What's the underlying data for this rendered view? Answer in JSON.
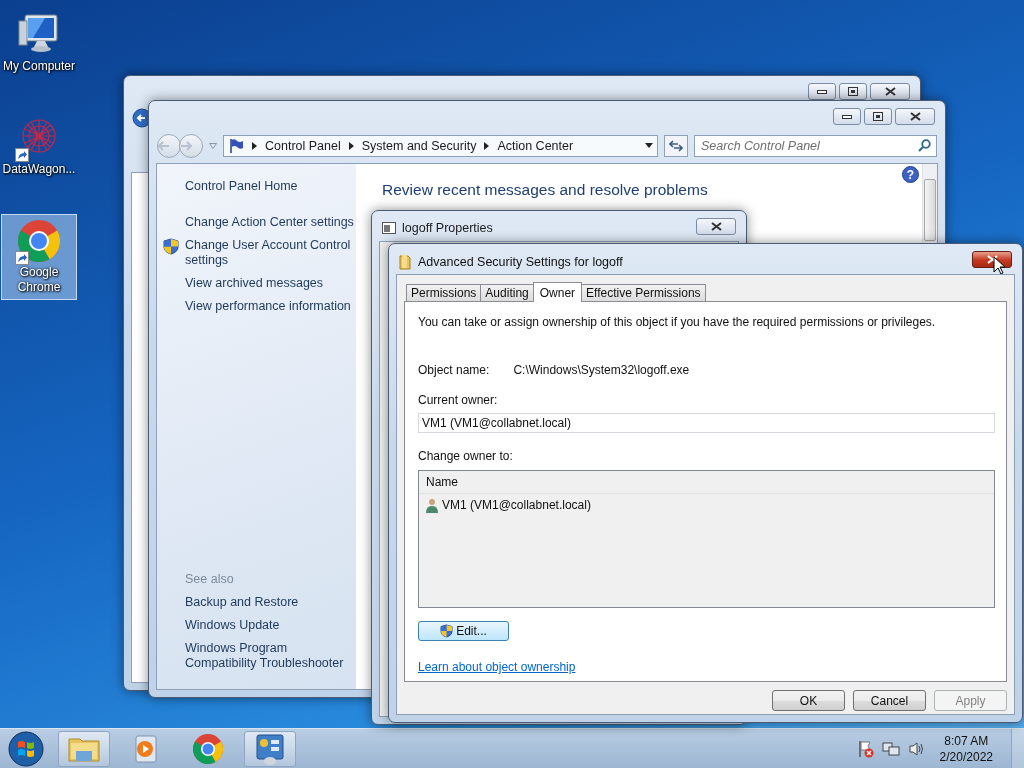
{
  "desktop_icons": [
    {
      "label": "My Computer",
      "selected": false
    },
    {
      "label": "DataWagon...",
      "selected": false
    },
    {
      "label": "Google Chrome",
      "selected": true
    }
  ],
  "control_panel": {
    "breadcrumb": [
      "Control Panel",
      "System and Security",
      "Action Center"
    ],
    "search": {
      "placeholder": "Search Control Panel"
    },
    "sidebar": {
      "home": "Control Panel Home",
      "tasks": [
        {
          "label": "Change Action Center settings",
          "kind": "plain"
        },
        {
          "label": "Change User Account Control settings",
          "kind": "shield"
        },
        {
          "label": "View archived messages",
          "kind": "plain"
        },
        {
          "label": "View performance information",
          "kind": "plain"
        }
      ],
      "see_also_title": "See also",
      "see_also": [
        "Backup and Restore",
        "Windows Update",
        "Windows Program Compatibility Troubleshooter"
      ]
    },
    "heading": "Review recent messages and resolve problems",
    "help_button": "?"
  },
  "properties_window": {
    "title": "logoff Properties"
  },
  "advanced_dialog": {
    "title": "Advanced Security Settings for logoff",
    "tabs": [
      {
        "label": "Permissions",
        "selected": false
      },
      {
        "label": "Auditing",
        "selected": false
      },
      {
        "label": "Owner",
        "selected": true
      },
      {
        "label": "Effective Permissions",
        "selected": false
      }
    ],
    "intro": "You can take or assign ownership of this object if you have the required permissions or privileges.",
    "object_name": {
      "label": "Object name:",
      "value": "C:\\Windows\\System32\\logoff.exe"
    },
    "current_owner": {
      "label": "Current owner:",
      "value": "VM1 (VM1@collabnet.local)"
    },
    "change_owner": {
      "label": "Change owner to:",
      "columns": [
        "Name"
      ],
      "rows": [
        {
          "name": "VM1 (VM1@collabnet.local)",
          "selected": false
        }
      ]
    },
    "edit_button": "Edit...",
    "link": "Learn about object ownership",
    "buttons": [
      {
        "label": "OK",
        "disabled": false
      },
      {
        "label": "Cancel",
        "disabled": false
      },
      {
        "label": "Apply",
        "disabled": true
      }
    ]
  },
  "taskbar": {
    "apps": [
      {
        "kind": "explorer",
        "running": true
      },
      {
        "kind": "media",
        "running": false
      },
      {
        "kind": "chrome",
        "running": false
      },
      {
        "kind": "control-panel",
        "running": true
      }
    ],
    "time": "8:07 AM",
    "date": "2/20/2022"
  }
}
